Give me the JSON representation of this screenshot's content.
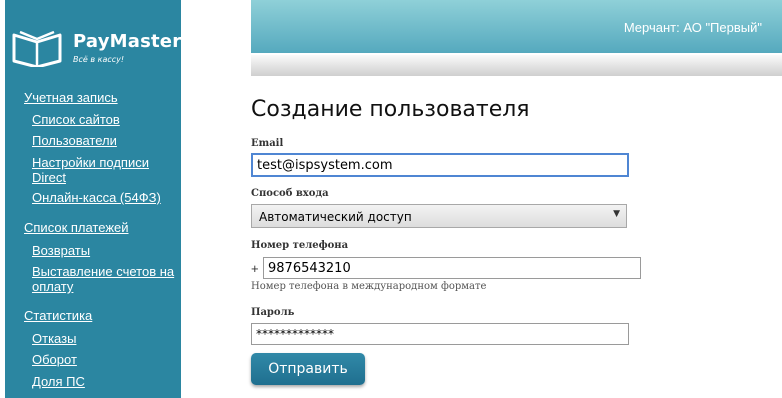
{
  "brand": {
    "name": "PayMaster",
    "tagline": "Всё в кассу!"
  },
  "sidebar": {
    "sections": [
      {
        "label": "Учетная запись",
        "items": [
          {
            "label": "Список сайтов"
          },
          {
            "label": "Пользователи"
          },
          {
            "label": "Настройки подписи Direct"
          },
          {
            "label": "Онлайн-касса (54ФЗ)"
          }
        ]
      },
      {
        "label": "Список платежей",
        "items": [
          {
            "label": "Возвраты"
          },
          {
            "label": "Выставление счетов на оплату"
          }
        ]
      },
      {
        "label": "Статистика",
        "items": [
          {
            "label": "Отказы"
          },
          {
            "label": "Оборот"
          },
          {
            "label": "Доля ПС"
          }
        ]
      }
    ]
  },
  "header": {
    "merchant": "Мерчант: АО \"Первый\""
  },
  "form": {
    "title": "Создание пользователя",
    "email": {
      "label": "Email",
      "value": "test@ispsystem.com"
    },
    "login_method": {
      "label": "Способ входа",
      "selected": "Автоматический доступ"
    },
    "phone": {
      "label": "Номер телефона",
      "prefix": "+",
      "value": "9876543210",
      "hint": "Номер телефона в международном формате"
    },
    "password": {
      "label": "Пароль",
      "value": "*************"
    },
    "submit_label": "Отправить"
  },
  "colors": {
    "sidebar_bg": "#2b86a1",
    "header_gradient_top": "#8fd0d8",
    "header_gradient_bottom": "#55a9be",
    "button_bg": "#2a7f9e",
    "focus_border": "#4f86d3"
  },
  "icons": {
    "logo": "open-book-logo-icon",
    "select_arrow": "triangle-down-icon"
  }
}
